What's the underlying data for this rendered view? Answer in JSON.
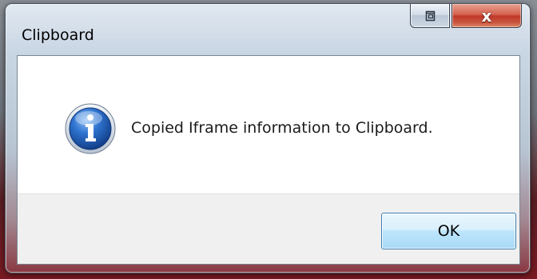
{
  "window": {
    "title": "Clipboard",
    "close_glyph": "x"
  },
  "message": {
    "text": "Copied Iframe information to Clipboard.",
    "icon": "info-icon"
  },
  "buttons": {
    "ok_label": "OK"
  },
  "colors": {
    "client_bg": "#ffffff",
    "button_bar_bg": "#f0f0f0",
    "close_red": "#c0392b",
    "ok_blue": "#a7d9f5",
    "info_icon_blue": "#1f5fb8"
  }
}
